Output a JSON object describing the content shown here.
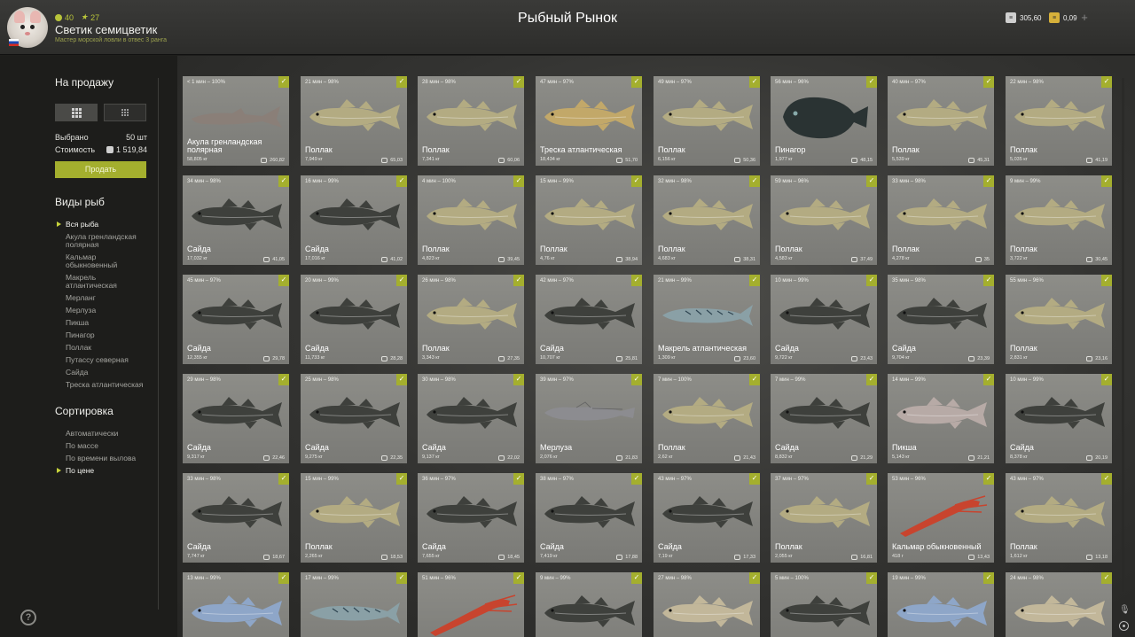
{
  "header": {
    "title": "Рыбный Рынок",
    "player_name": "Светик семицветик",
    "player_title": "Мастер морской ловли в отвес 3 ранга",
    "level": "40",
    "stars": "27",
    "silver": "305,60",
    "gold": "0,09",
    "plus": "+"
  },
  "sidebar": {
    "for_sale": "На продажу",
    "selected_label": "Выбрано",
    "selected_value": "50 шт",
    "cost_label": "Стоимость",
    "cost_value": "1 519,84",
    "sell_button": "Продать",
    "species_heading": "Виды рыб",
    "species": [
      "Вся рыба",
      "Акула гренландская полярная",
      "Кальмар обыкновенный",
      "Макрель атлантическая",
      "Мерланг",
      "Мерлуза",
      "Пикша",
      "Пинагор",
      "Поллак",
      "Путассу северная",
      "Сайда",
      "Треска атлантическая"
    ],
    "sort_heading": "Сортировка",
    "sort_options": [
      "Автоматически",
      "По массе",
      "По времени вылова",
      "По цене"
    ],
    "help": "?"
  },
  "cards": [
    {
      "time": "< 1 мин – 100%",
      "name": "Акула гренландская полярная",
      "weight": "58,805 кг",
      "price": "260,82",
      "kind": "shark",
      "color": "#8a7f78"
    },
    {
      "time": "21 мин – 98%",
      "name": "Поллак",
      "weight": "7,949 кг",
      "price": "65,03",
      "kind": "fish",
      "color": "#b3ab82"
    },
    {
      "time": "28 мин – 98%",
      "name": "Поллак",
      "weight": "7,341 кг",
      "price": "60,06",
      "kind": "fish",
      "color": "#b3ab82"
    },
    {
      "time": "47 мин – 97%",
      "name": "Треска атлантическая",
      "weight": "18,434 кг",
      "price": "51,70",
      "kind": "fish",
      "color": "#c2a869"
    },
    {
      "time": "49 мин – 97%",
      "name": "Поллак",
      "weight": "6,156 кг",
      "price": "50,36",
      "kind": "fish",
      "color": "#b3ab82"
    },
    {
      "time": "56 мин – 96%",
      "name": "Пинагор",
      "weight": "1,977 кг",
      "price": "48,15",
      "kind": "lump",
      "color": "#2a3333"
    },
    {
      "time": "40 мин – 97%",
      "name": "Поллак",
      "weight": "5,539 кг",
      "price": "45,31",
      "kind": "fish",
      "color": "#b3ab82"
    },
    {
      "time": "22 мин – 98%",
      "name": "Поллак",
      "weight": "5,035 кг",
      "price": "41,19",
      "kind": "fish",
      "color": "#b3ab82"
    },
    {
      "time": "34 мин – 98%",
      "name": "Сайда",
      "weight": "17,032 кг",
      "price": "41,05",
      "kind": "fish",
      "color": "#3e403c"
    },
    {
      "time": "16 мин – 99%",
      "name": "Сайда",
      "weight": "17,016 кг",
      "price": "41,02",
      "kind": "fish",
      "color": "#3e403c"
    },
    {
      "time": "4 мин – 100%",
      "name": "Поллак",
      "weight": "4,823 кг",
      "price": "39,45",
      "kind": "fish",
      "color": "#b3ab82"
    },
    {
      "time": "15 мин – 99%",
      "name": "Поллак",
      "weight": "4,76 кг",
      "price": "38,94",
      "kind": "fish",
      "color": "#b3ab82"
    },
    {
      "time": "32 мин – 98%",
      "name": "Поллак",
      "weight": "4,683 кг",
      "price": "38,31",
      "kind": "fish",
      "color": "#b3ab82"
    },
    {
      "time": "59 мин – 96%",
      "name": "Поллак",
      "weight": "4,583 кг",
      "price": "37,49",
      "kind": "fish",
      "color": "#b3ab82"
    },
    {
      "time": "33 мин – 98%",
      "name": "Поллак",
      "weight": "4,278 кг",
      "price": "35",
      "kind": "fish",
      "color": "#b3ab82"
    },
    {
      "time": "9 мин – 99%",
      "name": "Поллак",
      "weight": "3,722 кг",
      "price": "30,45",
      "kind": "fish",
      "color": "#b3ab82"
    },
    {
      "time": "45 мин – 97%",
      "name": "Сайда",
      "weight": "12,355 кг",
      "price": "29,78",
      "kind": "fish",
      "color": "#3e403c"
    },
    {
      "time": "20 мин – 99%",
      "name": "Сайда",
      "weight": "11,733 кг",
      "price": "28,28",
      "kind": "fish",
      "color": "#3e403c"
    },
    {
      "time": "26 мин – 98%",
      "name": "Поллак",
      "weight": "3,343 кг",
      "price": "27,35",
      "kind": "fish",
      "color": "#b3ab82"
    },
    {
      "time": "42 мин – 97%",
      "name": "Сайда",
      "weight": "10,707 кг",
      "price": "25,81",
      "kind": "fish",
      "color": "#3e403c"
    },
    {
      "time": "21 мин – 99%",
      "name": "Макрель атлантическая",
      "weight": "1,309 кг",
      "price": "23,60",
      "kind": "mackerel",
      "color": "#8aa0a6"
    },
    {
      "time": "10 мин – 99%",
      "name": "Сайда",
      "weight": "9,722 кг",
      "price": "23,43",
      "kind": "fish",
      "color": "#3e403c"
    },
    {
      "time": "35 мин – 98%",
      "name": "Сайда",
      "weight": "9,704 кг",
      "price": "23,39",
      "kind": "fish",
      "color": "#3e403c"
    },
    {
      "time": "55 мин – 96%",
      "name": "Поллак",
      "weight": "2,831 кг",
      "price": "23,16",
      "kind": "fish",
      "color": "#b3ab82"
    },
    {
      "time": "29 мин – 98%",
      "name": "Сайда",
      "weight": "9,317 кг",
      "price": "22,46",
      "kind": "fish",
      "color": "#3e403c"
    },
    {
      "time": "25 мин – 98%",
      "name": "Сайда",
      "weight": "9,275 кг",
      "price": "22,35",
      "kind": "fish",
      "color": "#3e403c"
    },
    {
      "time": "30 мин – 98%",
      "name": "Сайда",
      "weight": "9,137 кг",
      "price": "22,02",
      "kind": "fish",
      "color": "#3e403c"
    },
    {
      "time": "39 мин – 97%",
      "name": "Мерлуза",
      "weight": "2,076 кг",
      "price": "21,83",
      "kind": "hake",
      "color": "#8c8c90"
    },
    {
      "time": "7 мин – 100%",
      "name": "Поллак",
      "weight": "2,62 кг",
      "price": "21,43",
      "kind": "fish",
      "color": "#b3ab82"
    },
    {
      "time": "7 мин – 99%",
      "name": "Сайда",
      "weight": "8,832 кг",
      "price": "21,29",
      "kind": "fish",
      "color": "#3e403c"
    },
    {
      "time": "14 мин – 99%",
      "name": "Пикша",
      "weight": "5,143 кг",
      "price": "21,21",
      "kind": "fish",
      "color": "#b7aaa6"
    },
    {
      "time": "10 мин – 99%",
      "name": "Сайда",
      "weight": "8,378 кг",
      "price": "20,19",
      "kind": "fish",
      "color": "#3e403c"
    },
    {
      "time": "33 мин – 98%",
      "name": "Сайда",
      "weight": "7,747 кг",
      "price": "18,67",
      "kind": "fish",
      "color": "#3e403c"
    },
    {
      "time": "15 мин – 99%",
      "name": "Поллак",
      "weight": "2,265 кг",
      "price": "18,53",
      "kind": "fish",
      "color": "#b3ab82"
    },
    {
      "time": "36 мин – 97%",
      "name": "Сайда",
      "weight": "7,655 кг",
      "price": "18,45",
      "kind": "fish",
      "color": "#3e403c"
    },
    {
      "time": "38 мин – 97%",
      "name": "Сайда",
      "weight": "7,419 кг",
      "price": "17,88",
      "kind": "fish",
      "color": "#3e403c"
    },
    {
      "time": "43 мин – 97%",
      "name": "Сайда",
      "weight": "7,19 кг",
      "price": "17,33",
      "kind": "fish",
      "color": "#3e403c"
    },
    {
      "time": "37 мин – 97%",
      "name": "Поллак",
      "weight": "2,055 кг",
      "price": "16,81",
      "kind": "fish",
      "color": "#b3ab82"
    },
    {
      "time": "53 мин – 96%",
      "name": "Кальмар обыкновенный",
      "weight": "418 г",
      "price": "13,43",
      "kind": "squid",
      "color": "#c8442e"
    },
    {
      "time": "43 мин – 97%",
      "name": "Поллак",
      "weight": "1,612 кг",
      "price": "13,18",
      "kind": "fish",
      "color": "#b3ab82"
    },
    {
      "time": "13 мин – 99%",
      "name": "",
      "weight": "",
      "price": "",
      "kind": "fish",
      "color": "#8ea6c8"
    },
    {
      "time": "17 мин – 99%",
      "name": "",
      "weight": "",
      "price": "",
      "kind": "mackerel",
      "color": "#8aa0a6"
    },
    {
      "time": "51 мин – 96%",
      "name": "",
      "weight": "",
      "price": "",
      "kind": "squid",
      "color": "#c8442e"
    },
    {
      "time": "9 мин – 99%",
      "name": "",
      "weight": "",
      "price": "",
      "kind": "fish",
      "color": "#3e403c"
    },
    {
      "time": "27 мин – 98%",
      "name": "",
      "weight": "",
      "price": "",
      "kind": "fish",
      "color": "#c2b79a"
    },
    {
      "time": "5 мин – 100%",
      "name": "",
      "weight": "",
      "price": "",
      "kind": "fish",
      "color": "#3e403c"
    },
    {
      "time": "19 мин – 99%",
      "name": "",
      "weight": "",
      "price": "",
      "kind": "fish",
      "color": "#8ea6c8"
    },
    {
      "time": "24 мин – 98%",
      "name": "",
      "weight": "",
      "price": "",
      "kind": "fish",
      "color": "#c2b79a"
    }
  ]
}
